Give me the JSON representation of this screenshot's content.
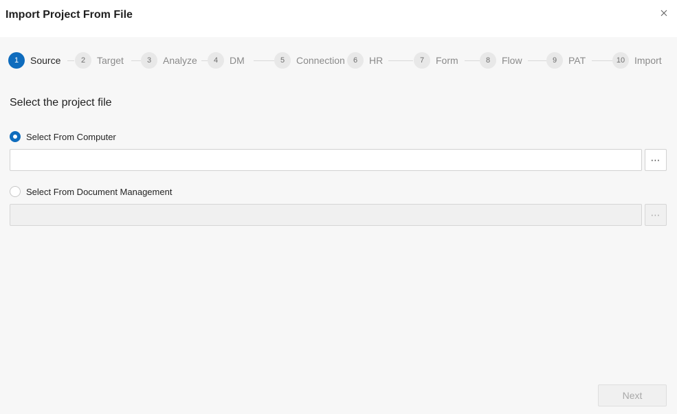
{
  "dialog": {
    "title": "Import Project From File",
    "close_icon": "close-icon"
  },
  "stepper": {
    "active_step": 1,
    "steps": [
      {
        "number": "1",
        "label": "Source"
      },
      {
        "number": "2",
        "label": "Target"
      },
      {
        "number": "3",
        "label": "Analyze"
      },
      {
        "number": "4",
        "label": "DM"
      },
      {
        "number": "5",
        "label": "Connection"
      },
      {
        "number": "6",
        "label": "HR"
      },
      {
        "number": "7",
        "label": "Form"
      },
      {
        "number": "8",
        "label": "Flow"
      },
      {
        "number": "9",
        "label": "PAT"
      },
      {
        "number": "10",
        "label": "Import"
      }
    ]
  },
  "source": {
    "section_title": "Select the project file",
    "computer_option": {
      "label": "Select From Computer",
      "selected": true,
      "value": "",
      "browse_label": "⋯"
    },
    "dm_option": {
      "label": "Select From Document Management",
      "selected": false,
      "value": "",
      "browse_label": "⋯"
    }
  },
  "footer": {
    "next_label": "Next"
  },
  "colors": {
    "accent": "#0f6cbd",
    "disabled_bg": "#f0f0f0",
    "page_bg": "#f7f7f7"
  }
}
